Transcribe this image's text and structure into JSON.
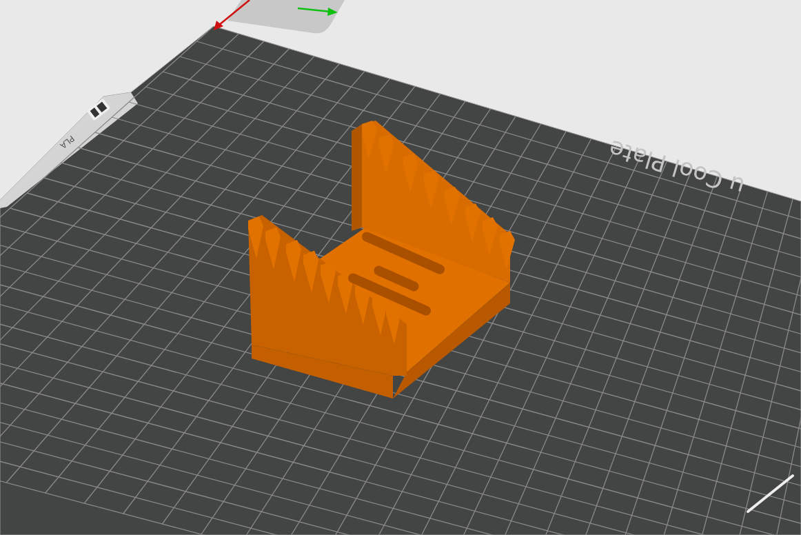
{
  "viewport": {
    "plate_label": "u Cool Plate",
    "filament_label": "PLA"
  }
}
